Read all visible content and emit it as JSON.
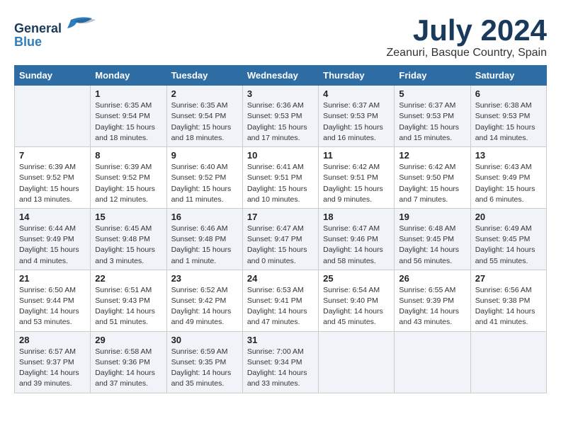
{
  "header": {
    "logo_line1": "General",
    "logo_line2": "Blue",
    "month": "July 2024",
    "location": "Zeanuri, Basque Country, Spain"
  },
  "days_of_week": [
    "Sunday",
    "Monday",
    "Tuesday",
    "Wednesday",
    "Thursday",
    "Friday",
    "Saturday"
  ],
  "weeks": [
    [
      {
        "day": "",
        "info": ""
      },
      {
        "day": "1",
        "info": "Sunrise: 6:35 AM\nSunset: 9:54 PM\nDaylight: 15 hours\nand 18 minutes."
      },
      {
        "day": "2",
        "info": "Sunrise: 6:35 AM\nSunset: 9:54 PM\nDaylight: 15 hours\nand 18 minutes."
      },
      {
        "day": "3",
        "info": "Sunrise: 6:36 AM\nSunset: 9:53 PM\nDaylight: 15 hours\nand 17 minutes."
      },
      {
        "day": "4",
        "info": "Sunrise: 6:37 AM\nSunset: 9:53 PM\nDaylight: 15 hours\nand 16 minutes."
      },
      {
        "day": "5",
        "info": "Sunrise: 6:37 AM\nSunset: 9:53 PM\nDaylight: 15 hours\nand 15 minutes."
      },
      {
        "day": "6",
        "info": "Sunrise: 6:38 AM\nSunset: 9:53 PM\nDaylight: 15 hours\nand 14 minutes."
      }
    ],
    [
      {
        "day": "7",
        "info": "Sunrise: 6:39 AM\nSunset: 9:52 PM\nDaylight: 15 hours\nand 13 minutes."
      },
      {
        "day": "8",
        "info": "Sunrise: 6:39 AM\nSunset: 9:52 PM\nDaylight: 15 hours\nand 12 minutes."
      },
      {
        "day": "9",
        "info": "Sunrise: 6:40 AM\nSunset: 9:52 PM\nDaylight: 15 hours\nand 11 minutes."
      },
      {
        "day": "10",
        "info": "Sunrise: 6:41 AM\nSunset: 9:51 PM\nDaylight: 15 hours\nand 10 minutes."
      },
      {
        "day": "11",
        "info": "Sunrise: 6:42 AM\nSunset: 9:51 PM\nDaylight: 15 hours\nand 9 minutes."
      },
      {
        "day": "12",
        "info": "Sunrise: 6:42 AM\nSunset: 9:50 PM\nDaylight: 15 hours\nand 7 minutes."
      },
      {
        "day": "13",
        "info": "Sunrise: 6:43 AM\nSunset: 9:49 PM\nDaylight: 15 hours\nand 6 minutes."
      }
    ],
    [
      {
        "day": "14",
        "info": "Sunrise: 6:44 AM\nSunset: 9:49 PM\nDaylight: 15 hours\nand 4 minutes."
      },
      {
        "day": "15",
        "info": "Sunrise: 6:45 AM\nSunset: 9:48 PM\nDaylight: 15 hours\nand 3 minutes."
      },
      {
        "day": "16",
        "info": "Sunrise: 6:46 AM\nSunset: 9:48 PM\nDaylight: 15 hours\nand 1 minute."
      },
      {
        "day": "17",
        "info": "Sunrise: 6:47 AM\nSunset: 9:47 PM\nDaylight: 15 hours\nand 0 minutes."
      },
      {
        "day": "18",
        "info": "Sunrise: 6:47 AM\nSunset: 9:46 PM\nDaylight: 14 hours\nand 58 minutes."
      },
      {
        "day": "19",
        "info": "Sunrise: 6:48 AM\nSunset: 9:45 PM\nDaylight: 14 hours\nand 56 minutes."
      },
      {
        "day": "20",
        "info": "Sunrise: 6:49 AM\nSunset: 9:45 PM\nDaylight: 14 hours\nand 55 minutes."
      }
    ],
    [
      {
        "day": "21",
        "info": "Sunrise: 6:50 AM\nSunset: 9:44 PM\nDaylight: 14 hours\nand 53 minutes."
      },
      {
        "day": "22",
        "info": "Sunrise: 6:51 AM\nSunset: 9:43 PM\nDaylight: 14 hours\nand 51 minutes."
      },
      {
        "day": "23",
        "info": "Sunrise: 6:52 AM\nSunset: 9:42 PM\nDaylight: 14 hours\nand 49 minutes."
      },
      {
        "day": "24",
        "info": "Sunrise: 6:53 AM\nSunset: 9:41 PM\nDaylight: 14 hours\nand 47 minutes."
      },
      {
        "day": "25",
        "info": "Sunrise: 6:54 AM\nSunset: 9:40 PM\nDaylight: 14 hours\nand 45 minutes."
      },
      {
        "day": "26",
        "info": "Sunrise: 6:55 AM\nSunset: 9:39 PM\nDaylight: 14 hours\nand 43 minutes."
      },
      {
        "day": "27",
        "info": "Sunrise: 6:56 AM\nSunset: 9:38 PM\nDaylight: 14 hours\nand 41 minutes."
      }
    ],
    [
      {
        "day": "28",
        "info": "Sunrise: 6:57 AM\nSunset: 9:37 PM\nDaylight: 14 hours\nand 39 minutes."
      },
      {
        "day": "29",
        "info": "Sunrise: 6:58 AM\nSunset: 9:36 PM\nDaylight: 14 hours\nand 37 minutes."
      },
      {
        "day": "30",
        "info": "Sunrise: 6:59 AM\nSunset: 9:35 PM\nDaylight: 14 hours\nand 35 minutes."
      },
      {
        "day": "31",
        "info": "Sunrise: 7:00 AM\nSunset: 9:34 PM\nDaylight: 14 hours\nand 33 minutes."
      },
      {
        "day": "",
        "info": ""
      },
      {
        "day": "",
        "info": ""
      },
      {
        "day": "",
        "info": ""
      }
    ]
  ]
}
